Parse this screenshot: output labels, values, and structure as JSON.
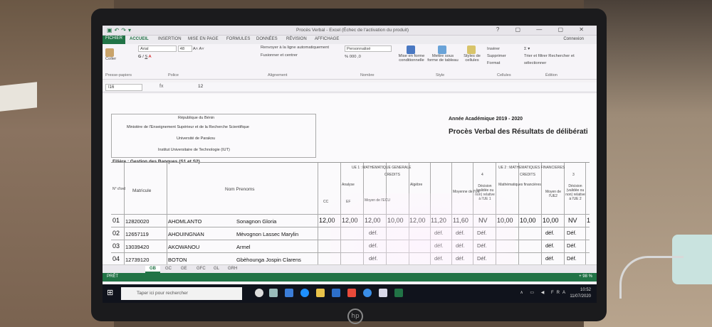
{
  "window": {
    "title": "Procès Verbal - Excel (Échec de l'activation du produit)",
    "connexion": "Connexion",
    "controls": "? ▢ — ▢ ✕"
  },
  "menu": [
    "FICHIER",
    "ACCUEIL",
    "INSERTION",
    "MISE EN PAGE",
    "FORMULES",
    "DONNÉES",
    "RÉVISION",
    "AFFICHAGE"
  ],
  "ribbon": {
    "paste_label": "Coller",
    "font_name": "Arial",
    "font_size": "48",
    "wrap_label": "Renvoyer à la ligne automatiquement",
    "merge_label": "Fusionner et centrer",
    "number_format": "Personnalisé",
    "conditional_label": "Mise en forme conditionnelle",
    "table_label": "Mettre sous forme de tableau",
    "styles_label": "Styles de cellules",
    "insert_label": "Insérer",
    "delete_label": "Supprimer",
    "format_label": "Format",
    "sort_label": "Trier et filtrer",
    "find_label": "Rechercher et sélectionner",
    "groups": [
      "Presse-papiers",
      "Police",
      "Alignement",
      "Nombre",
      "Style",
      "Cellules",
      "Édition"
    ]
  },
  "formula_bar": {
    "cell": "I16",
    "fx": "fx",
    "value": "12"
  },
  "sheet": {
    "header_lines": [
      "République du Bénin",
      "Ministère de l'Enseignement Supérieur et de la Recherche Scientifique",
      "Université de Parakou",
      "Institut Universitaire de Technologie (IUT)"
    ],
    "annee": "Année Académique 2019 - 2020",
    "pv_title": "Procès Verbal des Résultats de délibérati",
    "filiere": "Filière : Gestion des Banques  (S1 et S2)",
    "col_headers": {
      "num": "N° d'ord",
      "matricule": "Matricule",
      "nom": "Nom Prenoms",
      "ue1": "UE 1 : MATHEMATIQUE GENERALE",
      "credits1": "CREDITS",
      "analyse": "Analyse",
      "algebre": "Algèbre",
      "cc": "CC",
      "ef": "EF",
      "moy_ecu": "Moyen de l'ECU",
      "moy_ue": "Moyenne de l'UE",
      "decision": "Décision (validée ou non) relative à l'UE 1",
      "ue2": "UE 2 : MATHEMATIQUES FINANCIERES",
      "credits2": "CREDITS",
      "math_fin": "Mathématiques financières",
      "moy_ue2": "Moyen de l'UE2",
      "decision2": "Décision (validée ou non) relative à l'UE 2",
      "four": "4",
      "three": "3"
    },
    "rows": [
      {
        "num": "01",
        "matricule": "12820020",
        "nom": "AHOMLANTO",
        "prenom": "Sonagnon Gloria",
        "a_cc": "12,00",
        "a_ef": "12,00",
        "a_moy": "12,00",
        "g_cc": "10,00",
        "g_ef": "12,00",
        "g_moy": "11,20",
        "ue": "11,60",
        "dec": "NV",
        "f_cc": "10,00",
        "f_ef": "10,00",
        "ue2": "10,00",
        "dec2": "NV",
        "extra": "1"
      },
      {
        "num": "02",
        "matricule": "12657119",
        "nom": "AHOUINGNAN",
        "prenom": "Mèvognon Lassec Marylin",
        "a_cc": "",
        "a_ef": "",
        "a_moy": "déf.",
        "g_cc": "",
        "g_ef": "",
        "g_moy": "déf.",
        "ue": "déf.",
        "dec": "Déf.",
        "f_cc": "",
        "f_ef": "",
        "ue2": "déf.",
        "dec2": "Déf.",
        "extra": ""
      },
      {
        "num": "03",
        "matricule": "13039420",
        "nom": "AKOWANOU",
        "prenom": "Armel",
        "a_cc": "",
        "a_ef": "",
        "a_moy": "déf.",
        "g_cc": "",
        "g_ef": "",
        "g_moy": "déf.",
        "ue": "déf.",
        "dec": "Déf.",
        "f_cc": "",
        "f_ef": "",
        "ue2": "déf.",
        "dec2": "Déf.",
        "extra": ""
      },
      {
        "num": "04",
        "matricule": "12739120",
        "nom": "BOTON",
        "prenom": "Gbèhounga Jospin Clarens",
        "a_cc": "",
        "a_ef": "",
        "a_moy": "déf.",
        "g_cc": "",
        "g_ef": "",
        "g_moy": "déf.",
        "ue": "déf.",
        "dec": "Déf.",
        "f_cc": "",
        "f_ef": "",
        "ue2": "déf.",
        "dec2": "Déf.",
        "extra": ""
      }
    ],
    "tabs": [
      "GB",
      "GC",
      "GE",
      "GFC",
      "GL",
      "GRH"
    ]
  },
  "status": {
    "ready": "PRÊT",
    "zoom": "+ 98 %"
  },
  "taskbar": {
    "search": "Taper ici pour rechercher",
    "lang": "FRA",
    "time": "10:52",
    "date": "11/07/2020"
  }
}
